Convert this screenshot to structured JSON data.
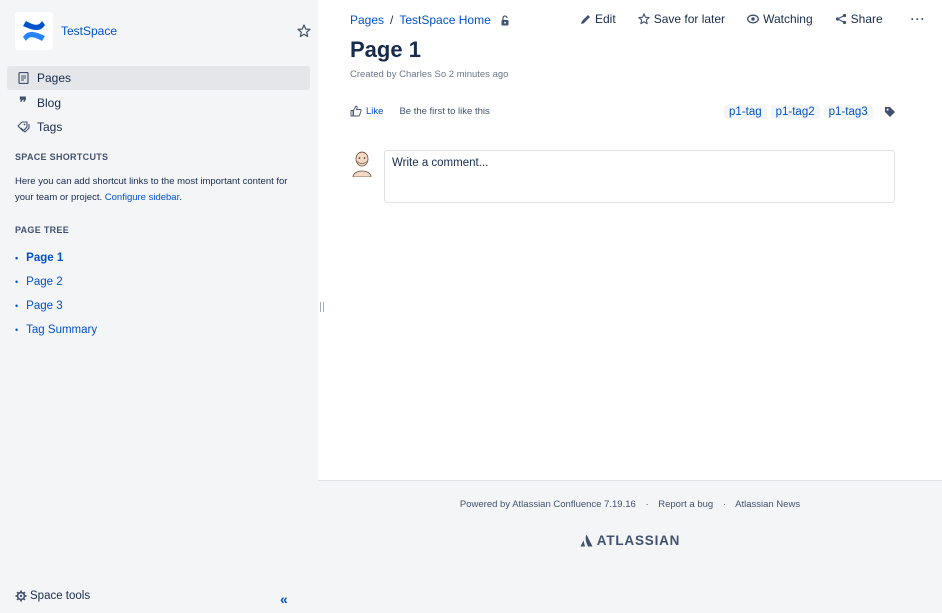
{
  "space": {
    "name": "TestSpace"
  },
  "nav": {
    "items": [
      {
        "label": "Pages",
        "icon": "pages-icon"
      },
      {
        "label": "Blog",
        "icon": "blog-quote-icon"
      },
      {
        "label": "Tags",
        "icon": "tags-icon"
      }
    ]
  },
  "shortcuts": {
    "title": "SPACE SHORTCUTS",
    "text": "Here you can add shortcut links to the most important content for your team or project.",
    "link": "Configure sidebar."
  },
  "page_tree": {
    "title": "PAGE TREE",
    "items": [
      "Page 1",
      "Page 2",
      "Page 3",
      "Tag Summary"
    ]
  },
  "sidebar_footer": {
    "space_tools": "Space tools",
    "collapse": "«"
  },
  "breadcrumb": {
    "items": [
      "Pages",
      "TestSpace Home"
    ],
    "separator": "/"
  },
  "actions": {
    "edit": "Edit",
    "save_for_later": "Save for later",
    "watching": "Watching",
    "share": "Share",
    "more": "···"
  },
  "page": {
    "title": "Page 1",
    "byline": "Created by Charles So 2 minutes ago"
  },
  "like": {
    "button": "Like",
    "text": "Be the first to like this"
  },
  "labels": [
    "p1-tag",
    "p1-tag2",
    "p1-tag3"
  ],
  "comment": {
    "placeholder": "Write a comment..."
  },
  "footer": {
    "powered_by": "Powered by Atlassian Confluence 7.19.16",
    "report_bug": "Report a bug",
    "news": "Atlassian News",
    "dot": "·",
    "logo_text": "ATLASSIAN"
  },
  "colors": {
    "link": "#0052cc",
    "text": "#172b4d",
    "sidebar_bg": "#f4f5f7"
  }
}
